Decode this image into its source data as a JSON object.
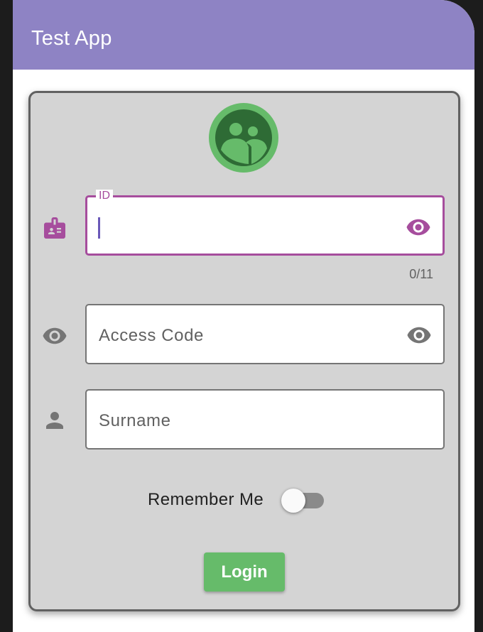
{
  "app": {
    "title": "Test App"
  },
  "form": {
    "id_field": {
      "label": "ID",
      "value": "",
      "counter": "0/11"
    },
    "access_code_field": {
      "placeholder": "Access Code"
    },
    "surname_field": {
      "placeholder": "Surname"
    },
    "remember_me": {
      "label": "Remember Me",
      "checked": false
    },
    "login_button": {
      "label": "Login"
    }
  },
  "colors": {
    "app_bar": "#8e83c4",
    "accent": "#a64d9d",
    "card_background": "#d4d4d4",
    "login_button": "#66bb6a",
    "avatar": "#66bb6a"
  },
  "icons": [
    "groups-avatar-icon",
    "badge-icon",
    "visibility-icon",
    "person-icon"
  ]
}
